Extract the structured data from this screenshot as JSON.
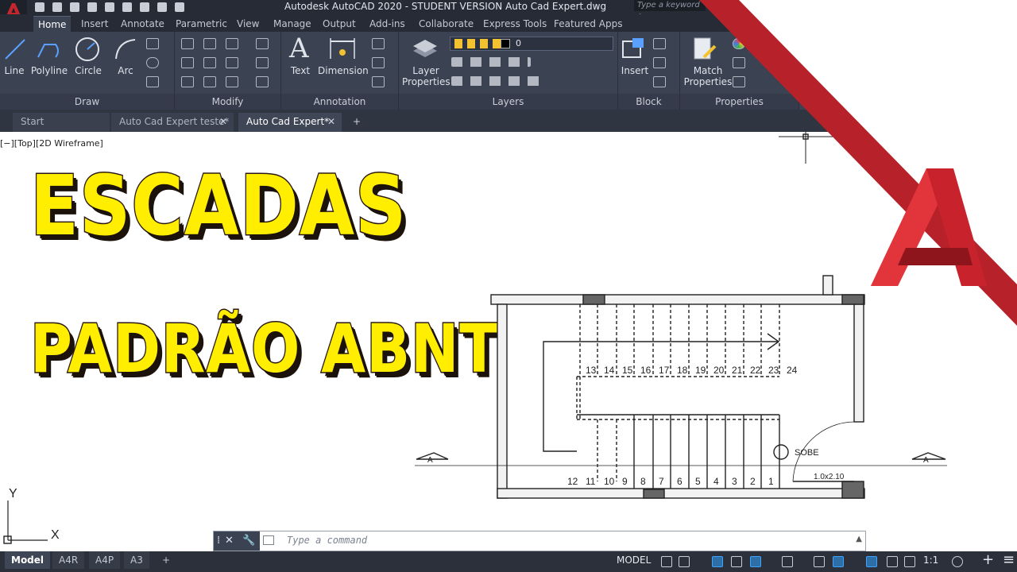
{
  "window": {
    "title": "Autodesk AutoCAD 2020 - STUDENT VERSION    Auto Cad Expert.dwg",
    "search_placeholder": "Type a keyword o"
  },
  "ribbon_tabs": [
    "Home",
    "Insert",
    "Annotate",
    "Parametric",
    "View",
    "Manage",
    "Output",
    "Add-ins",
    "Collaborate",
    "Express Tools",
    "Featured Apps"
  ],
  "panels": {
    "draw": "Draw",
    "modify": "Modify",
    "annotation": "Annotation",
    "layers": "Layers",
    "block": "Block",
    "properties": "Properties"
  },
  "tools": {
    "line": "Line",
    "polyline": "Polyline",
    "circle": "Circle",
    "arc": "Arc",
    "text": "Text",
    "dimension": "Dimension",
    "layer_properties_1": "Layer",
    "layer_properties_2": "Properties",
    "insert": "Insert",
    "match_1": "Match",
    "match_2": "Properties",
    "layer_value": "0"
  },
  "doc_tabs": {
    "start": "Start",
    "tab1": "Auto Cad Expert teste*",
    "tab2": "Auto Cad Expert*",
    "close": "✕",
    "add": "+"
  },
  "viewport_label": "[−][Top][2D Wireframe]",
  "thumbnail": {
    "line1": "ESCADAS",
    "line2": "PADRÃO ABNT"
  },
  "drawing": {
    "step_numbers_top": [
      "13",
      "14",
      "15",
      "16",
      "17",
      "18",
      "19",
      "20",
      "21",
      "22",
      "23",
      "24"
    ],
    "step_numbers_bottom": [
      "12",
      "11",
      "10",
      "9",
      "8",
      "7",
      "6",
      "5",
      "4",
      "3",
      "2",
      "1"
    ],
    "sobe": "SOBE",
    "door": "1.0x2.10",
    "section_mark": "A",
    "ucs_x": "X",
    "ucs_y": "Y"
  },
  "command": {
    "placeholder": "Type a command"
  },
  "layout_tabs": [
    "Model",
    "A4R",
    "A4P",
    "A3"
  ],
  "status": {
    "model": "MODEL",
    "scale": "1:1"
  },
  "colors": {
    "ribbon": "#3b4252",
    "dark": "#262b36",
    "brand_red": "#c4262e",
    "thumb_yellow": "#ffee00"
  }
}
